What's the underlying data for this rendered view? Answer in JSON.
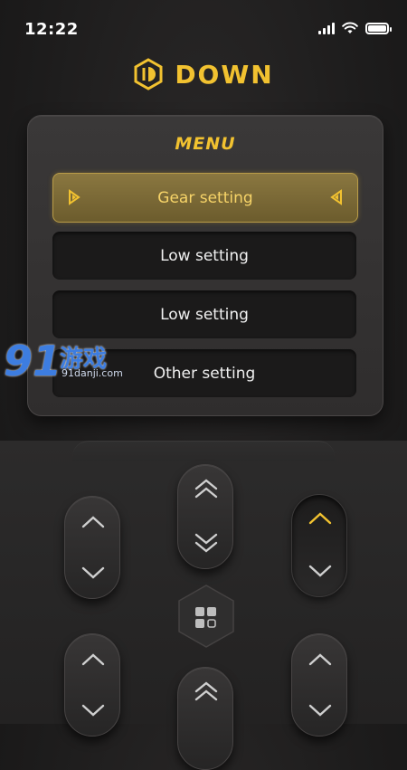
{
  "status": {
    "time": "12:22"
  },
  "brand": {
    "name": "DOWN",
    "color": "#f2c230"
  },
  "menu": {
    "title": "MENU",
    "items": [
      {
        "label": "Gear setting",
        "active": true
      },
      {
        "label": "Low setting",
        "active": false
      },
      {
        "label": "Low setting",
        "active": false
      },
      {
        "label": "Other setting",
        "active": false
      }
    ]
  },
  "watermark": {
    "number": "91",
    "text": "游戏",
    "url": "91danji.com"
  },
  "controls": {
    "buttons": [
      {
        "name": "left-up-down-rocker",
        "icons": [
          "chevron-up-icon",
          "chevron-down-icon"
        ]
      },
      {
        "name": "center-double-rocker",
        "icons": [
          "double-chevron-up-icon",
          "double-chevron-down-icon"
        ]
      },
      {
        "name": "right-up-down-rocker",
        "icons": [
          "chevron-up-icon",
          "chevron-down-icon"
        ],
        "active_color": "#f2c230"
      },
      {
        "name": "grid-menu-button",
        "icons": [
          "grid-icon"
        ]
      }
    ]
  },
  "colors": {
    "accent": "#f2c230",
    "background": "#1d1c1c"
  }
}
